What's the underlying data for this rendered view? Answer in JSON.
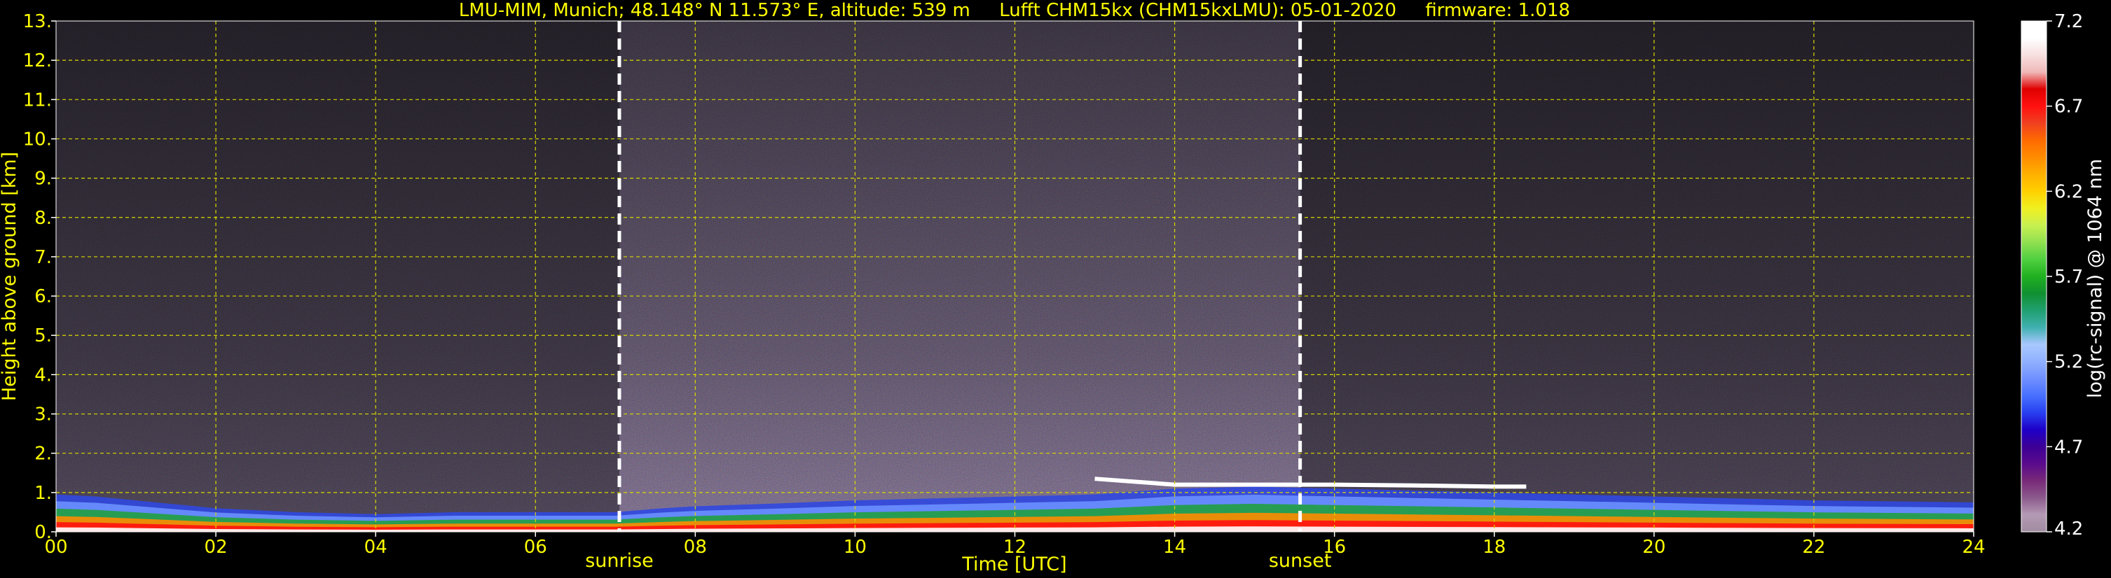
{
  "chart_data": {
    "type": "heatmap",
    "title": "LMU-MIM, Munich; 48.148° N 11.573° E, altitude: 539 m     Lufft CHM15kx (CHM15kxLMU): 05-01-2020     firmware: 1.018",
    "xlabel": "Time [UTC]",
    "ylabel": "Height above ground [km]",
    "colorbar_label": "log(rc-signal) @ 1064 nm",
    "xlim": [
      0,
      24
    ],
    "ylim": [
      0,
      13
    ],
    "x_ticks": [
      0,
      2,
      4,
      6,
      8,
      10,
      12,
      14,
      16,
      18,
      20,
      22,
      24
    ],
    "x_tick_labels": [
      "00",
      "02",
      "04",
      "06",
      "08",
      "10",
      "12",
      "14",
      "16",
      "18",
      "20",
      "22",
      "24"
    ],
    "y_ticks": [
      0,
      1,
      2,
      3,
      4,
      5,
      6,
      7,
      8,
      9,
      10,
      11,
      12,
      13
    ],
    "y_tick_labels": [
      "0.",
      "1.",
      "2.",
      "3.",
      "4.",
      "5.",
      "6.",
      "7.",
      "8.",
      "9.",
      "10.",
      "11.",
      "12.",
      "13."
    ],
    "colorbar_range": [
      4.2,
      7.2
    ],
    "colorbar_ticks": [
      4.2,
      4.7,
      5.2,
      5.7,
      6.2,
      6.7,
      7.2
    ],
    "colorbar_colors": [
      "#a08ca0",
      "#b49ab4",
      "#8c5a8c",
      "#782a78",
      "#5a0a8c",
      "#3c0096",
      "#1e00c8",
      "#2840f0",
      "#4870ff",
      "#7090ff",
      "#90b0ff",
      "#a8c8ff",
      "#40b0b0",
      "#20a070",
      "#109030",
      "#20b020",
      "#50d040",
      "#90e050",
      "#c8f050",
      "#f0f020",
      "#ffd000",
      "#ffb000",
      "#ff8c00",
      "#ff6a00",
      "#f04020",
      "#ff1010",
      "#e00000",
      "#f0b8b8",
      "#f8e0e0",
      "#ffffff",
      "#ffffff"
    ],
    "annotations": [
      {
        "label": "sunrise",
        "x": 7.05
      },
      {
        "label": "sunset",
        "x": 15.57
      }
    ],
    "grid": true,
    "text_color": "#ffff00",
    "grid_color": "#d8d800",
    "features": {
      "aerosol_layer_top_km": [
        [
          0,
          0.95
        ],
        [
          0.5,
          0.9
        ],
        [
          1.0,
          0.8
        ],
        [
          2.0,
          0.6
        ],
        [
          3.0,
          0.5
        ],
        [
          4.0,
          0.45
        ],
        [
          5.0,
          0.5
        ],
        [
          6.0,
          0.5
        ],
        [
          7.0,
          0.5
        ],
        [
          7.6,
          0.6
        ],
        [
          8.0,
          0.65
        ],
        [
          9.0,
          0.72
        ],
        [
          10.0,
          0.8
        ],
        [
          11.0,
          0.85
        ],
        [
          12.0,
          0.9
        ],
        [
          13.0,
          0.95
        ],
        [
          14.0,
          1.1
        ],
        [
          15.0,
          1.15
        ],
        [
          16.0,
          1.1
        ],
        [
          18.0,
          1.0
        ],
        [
          20.0,
          0.9
        ],
        [
          22.0,
          0.8
        ],
        [
          24.0,
          0.75
        ]
      ],
      "cloud_base_km": [
        [
          13.0,
          1.35
        ],
        [
          14.0,
          1.2
        ],
        [
          15.0,
          1.2
        ],
        [
          16.0,
          1.2
        ],
        [
          17.0,
          1.18
        ],
        [
          18.0,
          1.15
        ],
        [
          18.4,
          1.15
        ]
      ]
    }
  }
}
